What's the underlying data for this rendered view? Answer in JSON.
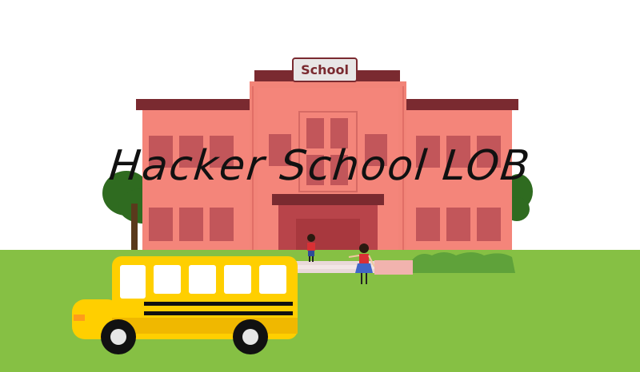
{
  "sign": {
    "text": "School"
  },
  "overlay": {
    "title": "Hacker School LOB"
  },
  "colors": {
    "sky": "#ffffff",
    "grass": "#86c044",
    "building": "#f4857a",
    "roof": "#7a2a30",
    "window": "#c2565a",
    "bus": "#ffcf00",
    "tree": "#2f6b20"
  }
}
